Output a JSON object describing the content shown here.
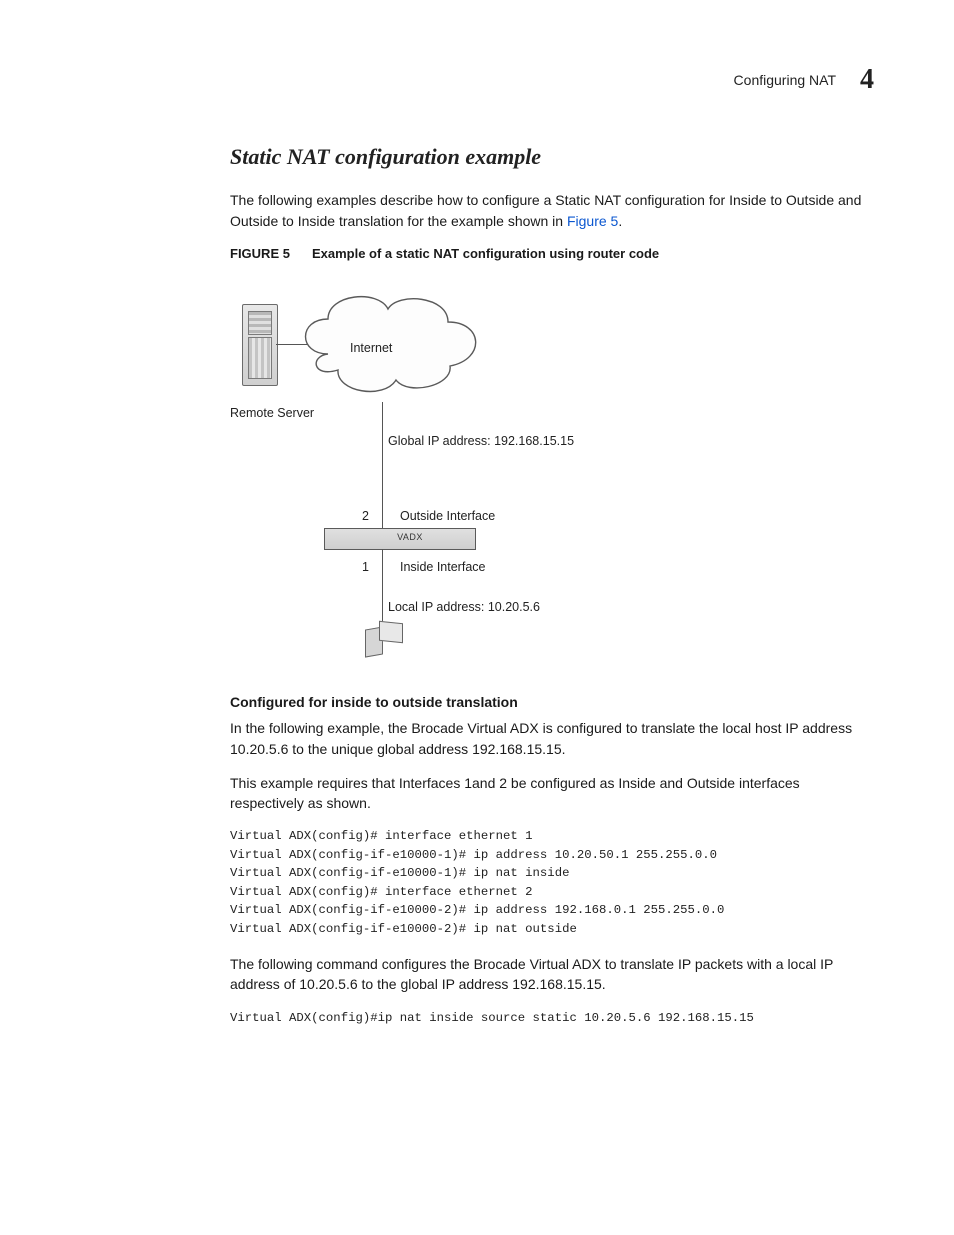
{
  "header": {
    "running_title": "Configuring NAT",
    "chapter_number": "4"
  },
  "section": {
    "title": "Static NAT configuration example",
    "intro_before_link": "The following examples describe how to configure a Static NAT configuration for Inside to Outside and Outside to Inside translation for the example shown in ",
    "intro_link": "Figure 5",
    "intro_after_link": "."
  },
  "figure": {
    "label": "FIGURE 5",
    "caption": "Example of a static NAT configuration using router code",
    "labels": {
      "remote_server": "Remote Server",
      "internet": "Internet",
      "global_ip": "Global IP address: 192.168.15.15",
      "port2": "2",
      "outside_interface": "Outside Interface",
      "vadx": "VADX",
      "port1": "1",
      "inside_interface": "Inside Interface",
      "local_ip": "Local IP address: 10.20.5.6"
    }
  },
  "inside_to_outside": {
    "heading": "Configured for inside to outside translation",
    "para1": "In the following example, the Brocade Virtual ADX is configured to translate the local host IP address 10.20.5.6 to the unique global address 192.168.15.15.",
    "para2": "This example requires that Interfaces 1and 2 be configured as Inside and Outside interfaces respectively as shown.",
    "cli1": "Virtual ADX(config)# interface ethernet 1\nVirtual ADX(config-if-e10000-1)# ip address 10.20.50.1 255.255.0.0\nVirtual ADX(config-if-e10000-1)# ip nat inside\nVirtual ADX(config)# interface ethernet 2\nVirtual ADX(config-if-e10000-2)# ip address 192.168.0.1 255.255.0.0\nVirtual ADX(config-if-e10000-2)# ip nat outside",
    "para3": "The following command configures the Brocade Virtual ADX to translate IP packets with a local IP address of 10.20.5.6 to the global IP address 192.168.15.15.",
    "cli2": "Virtual ADX(config)#ip nat inside source static 10.20.5.6 192.168.15.15"
  }
}
